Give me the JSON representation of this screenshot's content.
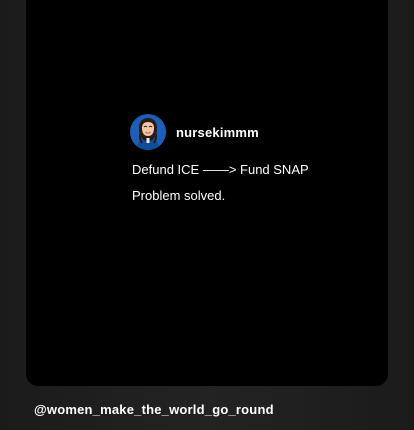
{
  "post": {
    "username": "nursekimmm",
    "lines": [
      "Defund ICE ——> Fund SNAP",
      "Problem solved."
    ]
  },
  "footer": {
    "handle": "@women_make_the_world_go_round"
  },
  "icons": {
    "avatar": "profile-photo"
  },
  "colors": {
    "background": "#1f1f1f",
    "card": "#000000",
    "text": "#ffffff"
  }
}
